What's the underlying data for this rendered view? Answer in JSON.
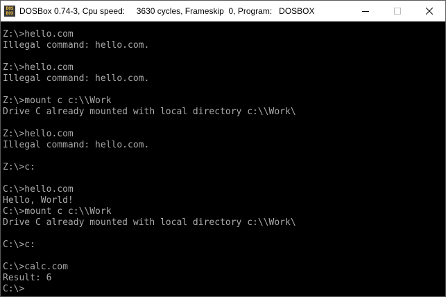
{
  "window": {
    "icon_text": [
      "DOS",
      "BOX"
    ],
    "title": "DOSBox 0.74-3, Cpu speed:     3630 cycles, Frameskip  0, Program:   DOSBOX"
  },
  "console": {
    "lines": [
      "Z:\\>hello.com",
      "Illegal command: hello.com.",
      "",
      "Z:\\>hello.com",
      "Illegal command: hello.com.",
      "",
      "Z:\\>mount c c:\\\\Work",
      "Drive C already mounted with local directory c:\\\\Work\\",
      "",
      "Z:\\>hello.com",
      "Illegal command: hello.com.",
      "",
      "Z:\\>c:",
      "",
      "C:\\>hello.com",
      "Hello, World!",
      "C:\\>mount c c:\\\\Work",
      "Drive C already mounted with local directory c:\\\\Work\\",
      "",
      "C:\\>c:",
      "",
      "C:\\>calc.com",
      "Result: 6",
      "C:\\>"
    ]
  }
}
